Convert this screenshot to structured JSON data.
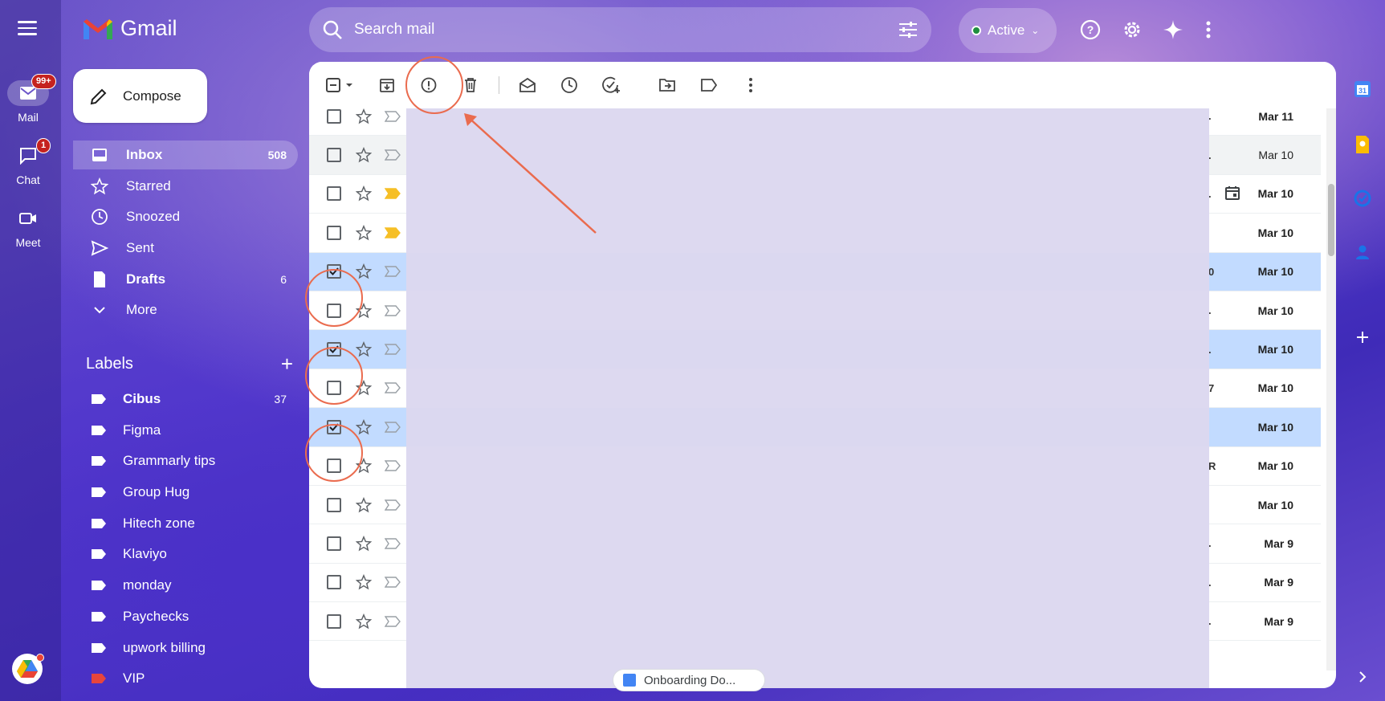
{
  "rail": {
    "items": [
      {
        "label": "Mail",
        "badge": "99+"
      },
      {
        "label": "Chat",
        "badge": "1"
      },
      {
        "label": "Meet"
      }
    ]
  },
  "logo": {
    "text": "Gmail"
  },
  "search": {
    "placeholder": "Search mail"
  },
  "status": {
    "label": "Active"
  },
  "compose": {
    "label": "Compose"
  },
  "nav": [
    {
      "label": "Inbox",
      "count": "508",
      "icon": "inbox-icon"
    },
    {
      "label": "Starred",
      "count": "",
      "icon": "star-icon"
    },
    {
      "label": "Snoozed",
      "count": "",
      "icon": "clock-icon"
    },
    {
      "label": "Sent",
      "count": "",
      "icon": "send-icon"
    },
    {
      "label": "Drafts",
      "count": "6",
      "icon": "draft-icon"
    },
    {
      "label": "More",
      "count": "",
      "icon": "chevron-down-icon"
    }
  ],
  "labels": {
    "title": "Labels",
    "items": [
      {
        "label": "Cibus",
        "count": "37",
        "color": "#ffffff"
      },
      {
        "label": "Figma",
        "count": "",
        "color": "#ffffff"
      },
      {
        "label": "Grammarly tips",
        "count": "",
        "color": "#ffffff"
      },
      {
        "label": "Group Hug",
        "count": "",
        "color": "#ffffff"
      },
      {
        "label": "Hitech zone",
        "count": "",
        "color": "#ffffff"
      },
      {
        "label": "Klaviyo",
        "count": "",
        "color": "#ffffff"
      },
      {
        "label": "monday",
        "count": "",
        "color": "#ffffff"
      },
      {
        "label": "Paychecks",
        "count": "",
        "color": "#ffffff"
      },
      {
        "label": "upwork billing",
        "count": "",
        "color": "#ffffff"
      },
      {
        "label": "VIP",
        "count": "",
        "color": "#e8453c"
      }
    ]
  },
  "toolbar": {
    "icons": [
      "select-all-checkbox-icon",
      "archive-icon",
      "report-spam-icon",
      "delete-icon",
      "mark-as-read-icon",
      "snooze-icon",
      "add-to-tasks-icon",
      "move-to-icon",
      "labels-icon",
      "more-vert-icon"
    ]
  },
  "rows": [
    {
      "date": "Mar 11",
      "state": "unread",
      "checked": false,
      "important": false,
      "trunc": "."
    },
    {
      "date": "Mar 10",
      "state": "hover",
      "checked": false,
      "important": false,
      "trunc": "."
    },
    {
      "date": "Mar 10",
      "state": "unread",
      "checked": false,
      "important": true,
      "trunc": ".",
      "calendar": true
    },
    {
      "date": "Mar 10",
      "state": "unread",
      "checked": false,
      "important": true,
      "trunc": ""
    },
    {
      "date": "Mar 10",
      "state": "selected",
      "checked": true,
      "important": false,
      "trunc": "0"
    },
    {
      "date": "Mar 10",
      "state": "unread",
      "checked": false,
      "important": false,
      "trunc": "."
    },
    {
      "date": "Mar 10",
      "state": "selected",
      "checked": true,
      "important": false,
      "trunc": "."
    },
    {
      "date": "Mar 10",
      "state": "unread",
      "checked": false,
      "important": false,
      "trunc": "7"
    },
    {
      "date": "Mar 10",
      "state": "selected",
      "checked": true,
      "important": false,
      "trunc": ""
    },
    {
      "date": "Mar 10",
      "state": "unread",
      "checked": false,
      "important": false,
      "trunc": "R"
    },
    {
      "date": "Mar 10",
      "state": "unread",
      "checked": false,
      "important": false,
      "trunc": ""
    },
    {
      "date": "Mar 9",
      "state": "unread",
      "checked": false,
      "important": false,
      "trunc": "."
    },
    {
      "date": "Mar 9",
      "state": "unread",
      "checked": false,
      "important": false,
      "trunc": "."
    },
    {
      "date": "Mar 9",
      "state": "unread",
      "checked": false,
      "important": false,
      "trunc": "."
    }
  ],
  "chip": {
    "label": "Onboarding Do..."
  },
  "colors": {
    "accent_annotation": "#ea6b4e",
    "selected_row": "#c2dbff",
    "important": "#f6bf26"
  }
}
